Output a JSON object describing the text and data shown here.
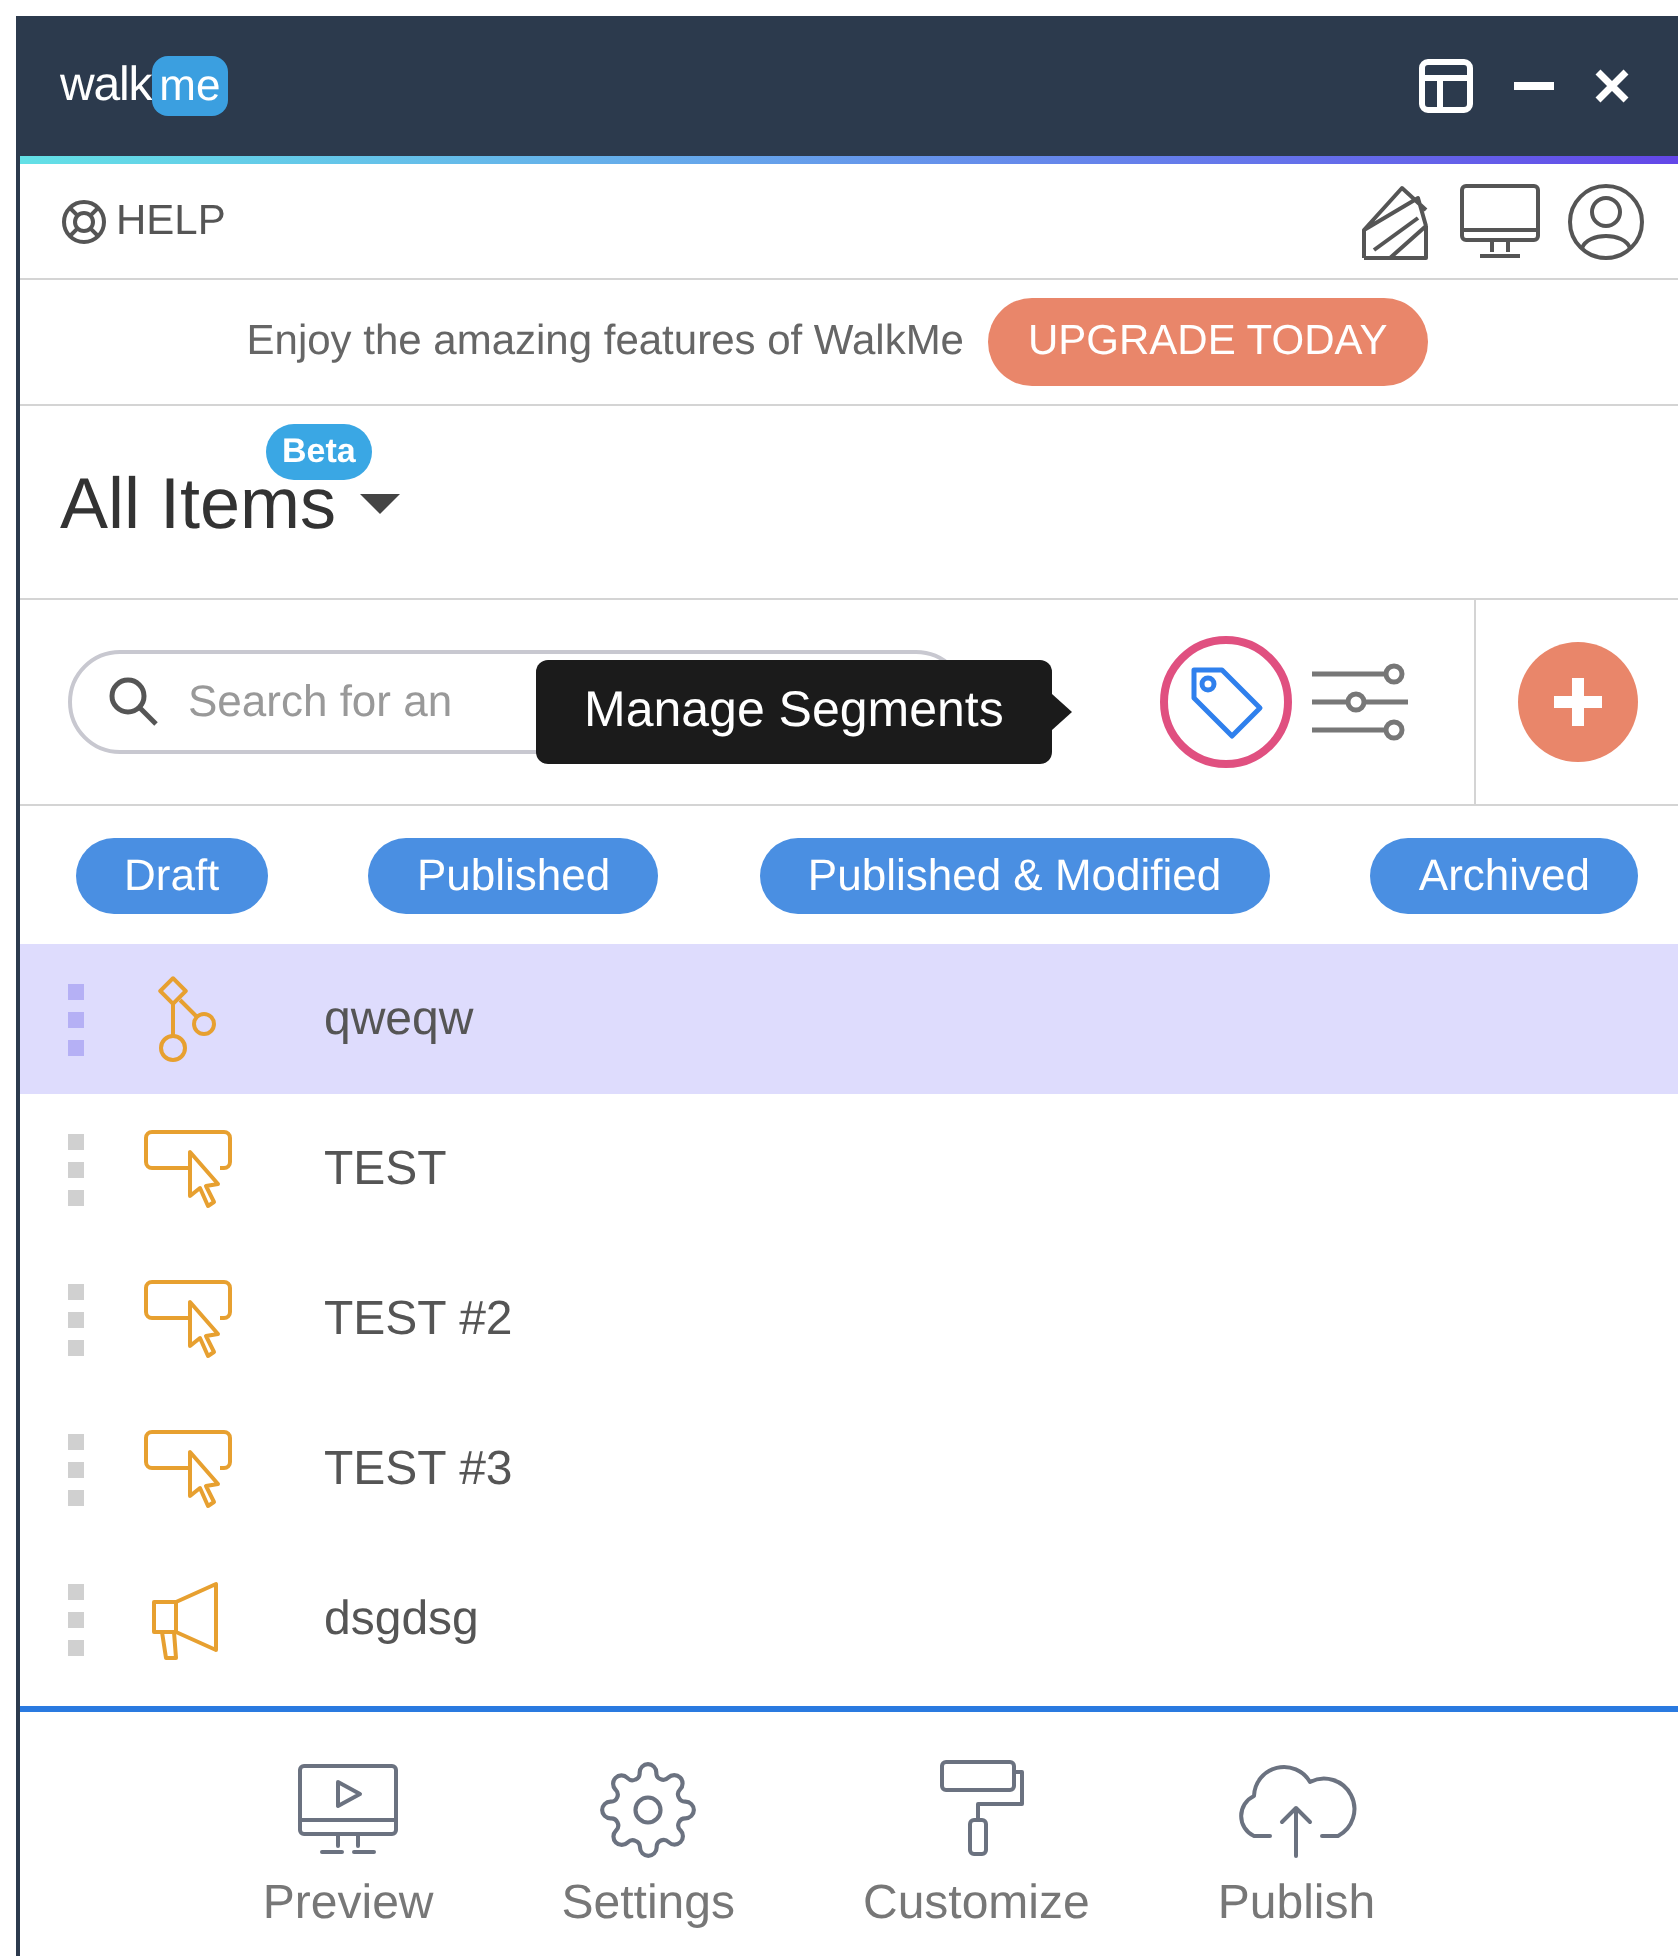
{
  "logo": {
    "part_1": "walk",
    "part_2": "me"
  },
  "help": {
    "label": "HELP"
  },
  "promo": {
    "text": "Enjoy the amazing features of WalkMe",
    "button": "UPGRADE TODAY"
  },
  "header": {
    "title": "All Items",
    "badge": "Beta"
  },
  "search": {
    "placeholder": "Search for an"
  },
  "tooltip": {
    "text": "Manage Segments"
  },
  "filters": [
    "Draft",
    "Published",
    "Published & Modified",
    "Archived"
  ],
  "items": [
    {
      "name": "qweqw",
      "kind": "flow",
      "selected": true
    },
    {
      "name": "TEST",
      "kind": "launcher",
      "selected": false
    },
    {
      "name": "TEST #2",
      "kind": "launcher",
      "selected": false
    },
    {
      "name": "TEST #3",
      "kind": "launcher",
      "selected": false
    },
    {
      "name": "dsgdsg",
      "kind": "shoutout",
      "selected": false
    }
  ],
  "footer": [
    {
      "label": "Preview",
      "kind": "preview"
    },
    {
      "label": "Settings",
      "kind": "settings"
    },
    {
      "label": "Customize",
      "kind": "customize"
    },
    {
      "label": "Publish",
      "kind": "publish"
    }
  ]
}
